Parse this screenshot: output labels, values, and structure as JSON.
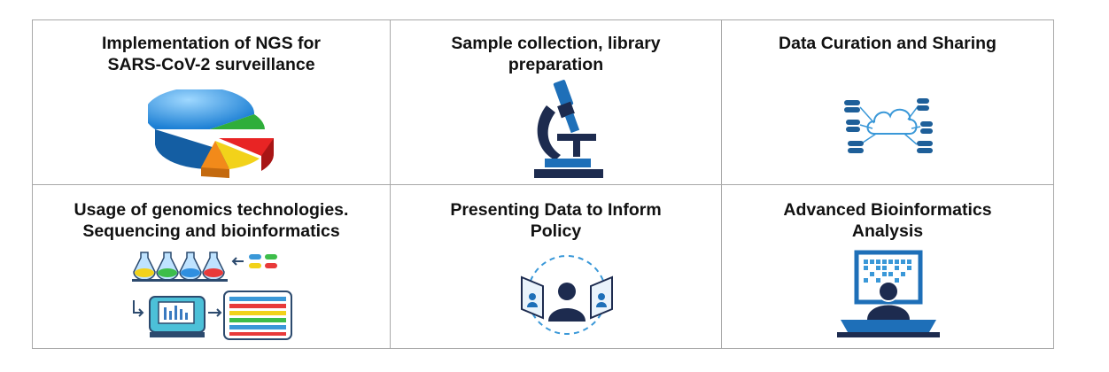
{
  "cells": [
    {
      "title_line1": "Implementation of NGS for",
      "title_line2": "SARS-CoV-2 surveillance",
      "icon": "pie-chart-icon"
    },
    {
      "title_line1": "Sample collection, library",
      "title_line2": "preparation",
      "icon": "microscope-icon"
    },
    {
      "title_line1": "Data Curation and Sharing",
      "title_line2": "",
      "icon": "cloud-database-icon"
    },
    {
      "title_line1": "Usage of genomics technologies.",
      "title_line2": "Sequencing and bioinformatics",
      "icon": "sequencing-lab-icon"
    },
    {
      "title_line1": "Presenting Data to Inform",
      "title_line2": "Policy",
      "icon": "presentation-audience-icon"
    },
    {
      "title_line1": "Advanced Bioinformatics",
      "title_line2": "Analysis",
      "icon": "computer-analyst-icon"
    }
  ],
  "colors": {
    "border": "#a8a8a8",
    "accent_blue": "#1e6fb8",
    "dark_navy": "#1d2b4f"
  }
}
